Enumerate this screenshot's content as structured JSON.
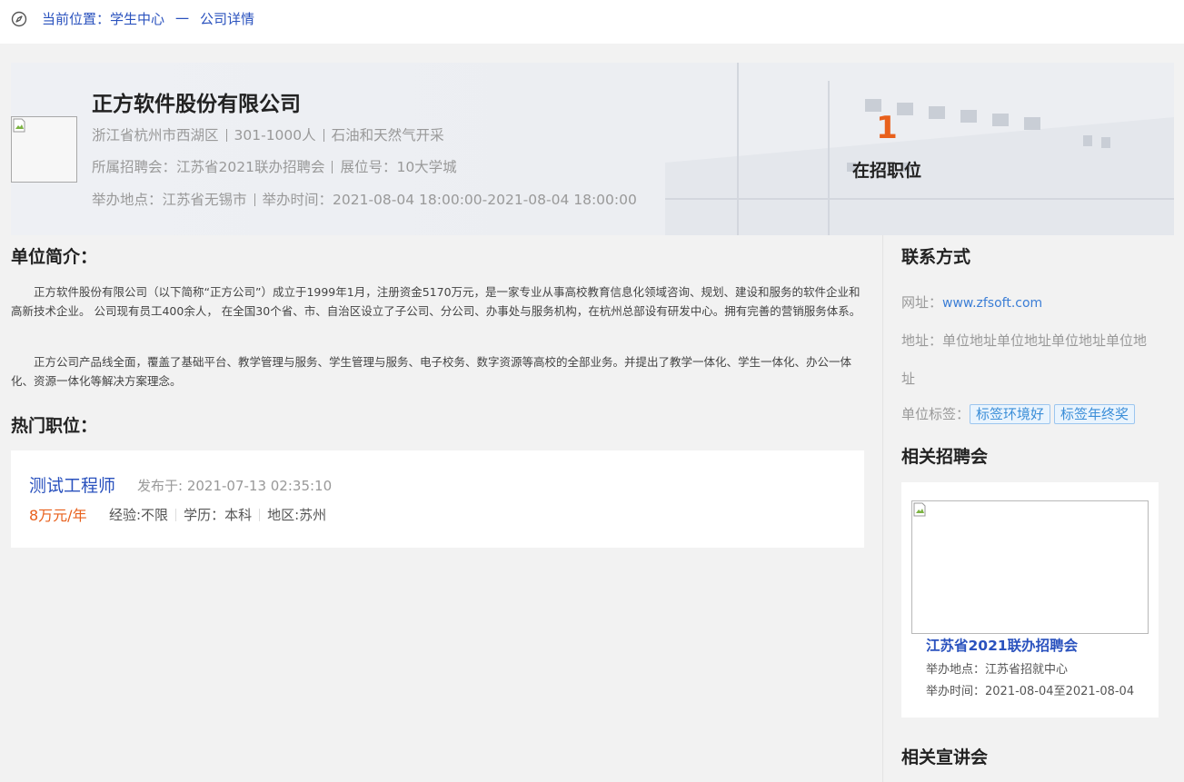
{
  "breadcrumb": {
    "prefix": "当前位置：",
    "home": "学生中心",
    "separator": "一",
    "current": "公司详情"
  },
  "company": {
    "name": "正方软件股份有限公司",
    "location": "浙江省杭州市西湖区",
    "size": "301-1000人",
    "industry": "石油和天然气开采",
    "fair": "所属招聘会：江苏省2021联办招聘会",
    "booth": "展位号：10大学城",
    "venue": "举办地点：江苏省无锡市",
    "time": "举办时间：2021-08-04 18:00:00-2021-08-04 18:00:00",
    "job_count": "1",
    "job_count_label": "在招职位"
  },
  "intro": {
    "title": "单位简介：",
    "paragraphs": [
      "正方软件股份有限公司（以下简称“正方公司”）成立于1999年1月，注册资金5170万元，是一家专业从事高校教育信息化领域咨询、规划、建设和服务的软件企业和高新技术企业。 公司现有员工400余人， 在全国30个省、市、自治区设立了子公司、分公司、办事处与服务机构，在杭州总部设有研发中心。拥有完善的营销服务体系。",
      "正方公司产品线全面，覆盖了基础平台、教学管理与服务、学生管理与服务、电子校务、数字资源等高校的全部业务。并提出了教学一体化、学生一体化、办公一体化、资源一体化等解决方案理念。"
    ]
  },
  "hot_jobs": {
    "title": "热门职位：",
    "items": [
      {
        "title": "测试工程师",
        "published": "发布于: 2021-07-13 02:35:10",
        "salary": "8万元/年",
        "experience": "经验:不限",
        "education": "学历：本科",
        "region": "地区:苏州"
      }
    ]
  },
  "contact": {
    "title": "联系方式",
    "website_label": "网址：",
    "website": "www.zfsoft.com",
    "address_label": "地址：",
    "address_line1": "单位地址单位地址单位地址单位地",
    "address_line2": "址",
    "tags_label": "单位标签：",
    "tags": [
      "标签环境好",
      "标签年终奖"
    ]
  },
  "related_fairs": {
    "title": "相关招聘会",
    "items": [
      {
        "name": "江苏省2021联办招聘会",
        "venue": "举办地点：江苏省招就中心",
        "time": "举办时间：2021-08-04至2021-08-04"
      }
    ]
  },
  "related_talks": {
    "title": "相关宣讲会"
  },
  "colors": {
    "link_blue": "#2a52be",
    "accent_orange": "#e8601c",
    "tag_blue": "#3b8ed8"
  }
}
